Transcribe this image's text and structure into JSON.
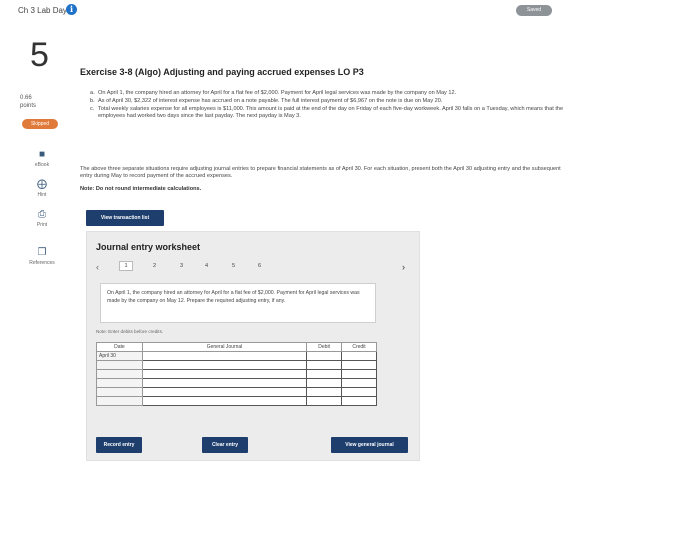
{
  "header": {
    "title": "Ch 3 Lab Day 2",
    "saved_label": "Saved"
  },
  "question": {
    "number": "5",
    "points": "0.66",
    "points_unit": "points",
    "status": "Skipped"
  },
  "sidebar": {
    "tools": [
      {
        "label": "eBook",
        "icon": "book-icon"
      },
      {
        "label": "Hint",
        "icon": "hint-icon"
      },
      {
        "label": "Print",
        "icon": "print-icon"
      },
      {
        "label": "References",
        "icon": "references-icon"
      }
    ]
  },
  "exercise": {
    "title": "Exercise 3-8 (Algo) Adjusting and paying accrued expenses LO P3",
    "parts": [
      {
        "letter": "a.",
        "text": "On April 1, the company hired an attorney for April for a flat fee of $2,000. Payment for April legal services was made by the company on May 12."
      },
      {
        "letter": "b.",
        "text": "As of April 30, $2,322 of interest expense has accrued on a note payable. The full interest payment of $6,967 on the note is due on May 20."
      },
      {
        "letter": "c.",
        "text": "Total weekly salaries expense for all employees is $11,000. This amount is paid at the end of the day on Friday of each five-day workweek. April 30 falls on a Tuesday, which means that the employees had worked two days since the last payday. The next payday is May 3."
      }
    ],
    "intro": "The above three separate situations require adjusting journal entries to prepare financial statements as of April 30. For each situation, present both the April 30 adjusting entry and the subsequent entry during May to record payment of the accrued expenses.",
    "note": "Note: Do not round intermediate calculations."
  },
  "buttons": {
    "view_transaction_list": "View transaction list",
    "record_entry": "Record entry",
    "clear_entry": "Clear entry",
    "view_general_journal": "View general journal"
  },
  "worksheet": {
    "title": "Journal entry worksheet",
    "pages": [
      "1",
      "2",
      "3",
      "4",
      "5",
      "6"
    ],
    "active_page": "1",
    "description": "On April 1, the company hired an attorney for April for a flat fee of $2,000. Payment for April legal services was made by the company on May 12. Prepare the required adjusting entry, if any.",
    "note": "Note: Enter debits before credits.",
    "columns": [
      "Date",
      "General Journal",
      "Debit",
      "Credit"
    ],
    "date_value": "April 30"
  },
  "colors": {
    "accent": "#1e3f6e",
    "skipped": "#e07a3b",
    "info": "#1e73c8"
  }
}
